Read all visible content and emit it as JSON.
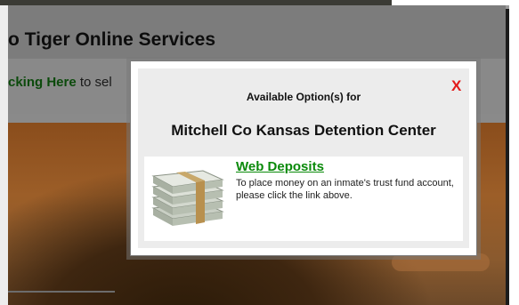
{
  "background": {
    "site_title": "o Tiger Online Services",
    "sub_text_link": "cking Here",
    "sub_text_rest": " to sel"
  },
  "modal": {
    "close_label": "X",
    "heading": "Available Option(s) for",
    "facility": "Mitchell Co Kansas Detention Center",
    "options": [
      {
        "title": "Web Deposits",
        "description": "To place money on an inmate's trust fund account, please click the link above.",
        "icon": "money-stack-icon"
      }
    ]
  },
  "colors": {
    "link_green": "#0a8a0a",
    "close_red": "#e31a1a"
  }
}
